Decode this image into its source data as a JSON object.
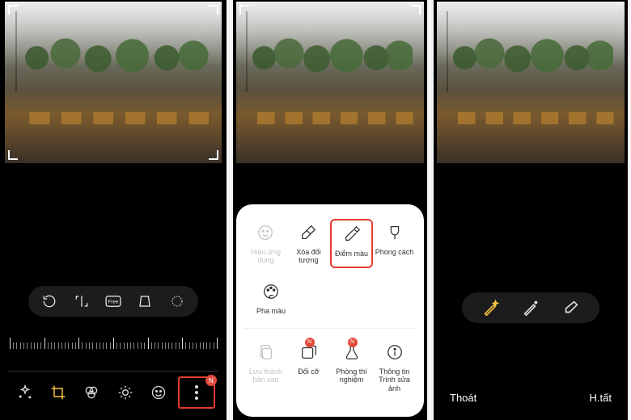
{
  "left": {
    "pill": [
      "rotate",
      "ratio-custom",
      "ratio-free",
      "perspective",
      "ellipse"
    ],
    "bottom_icons": [
      "sparkle",
      "crop",
      "filters",
      "brightness",
      "emoji",
      "more"
    ],
    "more_badge": "N"
  },
  "popup": {
    "row1": [
      {
        "key": "hieu-ung",
        "label": "Hiệu ứng dụng",
        "icon": "face",
        "dim": true
      },
      {
        "key": "xoa-doi-tuong",
        "label": "Xóa đối tượng",
        "icon": "eraser"
      },
      {
        "key": "diem-mau",
        "label": "Điểm màu",
        "icon": "eyedropper",
        "highlight": true
      },
      {
        "key": "phong-cach",
        "label": "Phong cách",
        "icon": "brush"
      }
    ],
    "row2": [
      {
        "key": "pha-mau",
        "label": "Pha màu",
        "icon": "palette"
      }
    ],
    "row3": [
      {
        "key": "luu-ban-sao",
        "label": "Lưu thành bản sao",
        "icon": "copy",
        "dim": true
      },
      {
        "key": "doi-co",
        "label": "Đổi cỡ",
        "icon": "resize",
        "badge": "N"
      },
      {
        "key": "phong-thi-nghiem",
        "label": "Phòng thí nghiệm",
        "icon": "flask",
        "badge": "N"
      },
      {
        "key": "thong-tin",
        "label": "Thông tin Trình sửa ảnh",
        "icon": "info"
      }
    ]
  },
  "right": {
    "tools": [
      "wand-auto",
      "wand",
      "eraser"
    ],
    "active_tool": "wand-auto",
    "footer": {
      "left": "Thoát",
      "right": "H.tất"
    }
  },
  "colors": {
    "accent": "#f5c542",
    "highlight_box": "#e23b2e",
    "badge": "#e24a3b"
  }
}
